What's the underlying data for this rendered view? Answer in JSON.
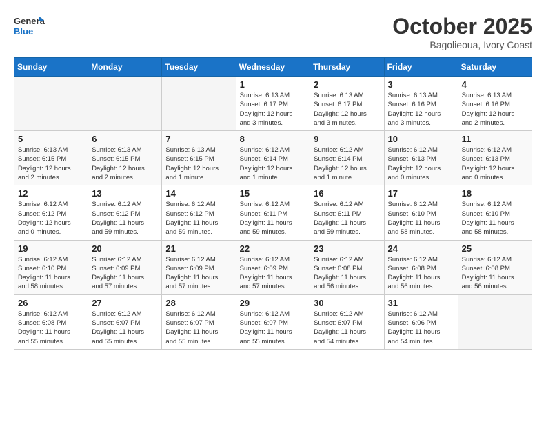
{
  "header": {
    "logo_line1": "General",
    "logo_line2": "Blue",
    "month": "October 2025",
    "location": "Bagolieoua, Ivory Coast"
  },
  "days_of_week": [
    "Sunday",
    "Monday",
    "Tuesday",
    "Wednesday",
    "Thursday",
    "Friday",
    "Saturday"
  ],
  "weeks": [
    [
      {
        "day": "",
        "info": ""
      },
      {
        "day": "",
        "info": ""
      },
      {
        "day": "",
        "info": ""
      },
      {
        "day": "1",
        "info": "Sunrise: 6:13 AM\nSunset: 6:17 PM\nDaylight: 12 hours\nand 3 minutes."
      },
      {
        "day": "2",
        "info": "Sunrise: 6:13 AM\nSunset: 6:17 PM\nDaylight: 12 hours\nand 3 minutes."
      },
      {
        "day": "3",
        "info": "Sunrise: 6:13 AM\nSunset: 6:16 PM\nDaylight: 12 hours\nand 3 minutes."
      },
      {
        "day": "4",
        "info": "Sunrise: 6:13 AM\nSunset: 6:16 PM\nDaylight: 12 hours\nand 2 minutes."
      }
    ],
    [
      {
        "day": "5",
        "info": "Sunrise: 6:13 AM\nSunset: 6:15 PM\nDaylight: 12 hours\nand 2 minutes."
      },
      {
        "day": "6",
        "info": "Sunrise: 6:13 AM\nSunset: 6:15 PM\nDaylight: 12 hours\nand 2 minutes."
      },
      {
        "day": "7",
        "info": "Sunrise: 6:13 AM\nSunset: 6:15 PM\nDaylight: 12 hours\nand 1 minute."
      },
      {
        "day": "8",
        "info": "Sunrise: 6:12 AM\nSunset: 6:14 PM\nDaylight: 12 hours\nand 1 minute."
      },
      {
        "day": "9",
        "info": "Sunrise: 6:12 AM\nSunset: 6:14 PM\nDaylight: 12 hours\nand 1 minute."
      },
      {
        "day": "10",
        "info": "Sunrise: 6:12 AM\nSunset: 6:13 PM\nDaylight: 12 hours\nand 0 minutes."
      },
      {
        "day": "11",
        "info": "Sunrise: 6:12 AM\nSunset: 6:13 PM\nDaylight: 12 hours\nand 0 minutes."
      }
    ],
    [
      {
        "day": "12",
        "info": "Sunrise: 6:12 AM\nSunset: 6:12 PM\nDaylight: 12 hours\nand 0 minutes."
      },
      {
        "day": "13",
        "info": "Sunrise: 6:12 AM\nSunset: 6:12 PM\nDaylight: 11 hours\nand 59 minutes."
      },
      {
        "day": "14",
        "info": "Sunrise: 6:12 AM\nSunset: 6:12 PM\nDaylight: 11 hours\nand 59 minutes."
      },
      {
        "day": "15",
        "info": "Sunrise: 6:12 AM\nSunset: 6:11 PM\nDaylight: 11 hours\nand 59 minutes."
      },
      {
        "day": "16",
        "info": "Sunrise: 6:12 AM\nSunset: 6:11 PM\nDaylight: 11 hours\nand 59 minutes."
      },
      {
        "day": "17",
        "info": "Sunrise: 6:12 AM\nSunset: 6:10 PM\nDaylight: 11 hours\nand 58 minutes."
      },
      {
        "day": "18",
        "info": "Sunrise: 6:12 AM\nSunset: 6:10 PM\nDaylight: 11 hours\nand 58 minutes."
      }
    ],
    [
      {
        "day": "19",
        "info": "Sunrise: 6:12 AM\nSunset: 6:10 PM\nDaylight: 11 hours\nand 58 minutes."
      },
      {
        "day": "20",
        "info": "Sunrise: 6:12 AM\nSunset: 6:09 PM\nDaylight: 11 hours\nand 57 minutes."
      },
      {
        "day": "21",
        "info": "Sunrise: 6:12 AM\nSunset: 6:09 PM\nDaylight: 11 hours\nand 57 minutes."
      },
      {
        "day": "22",
        "info": "Sunrise: 6:12 AM\nSunset: 6:09 PM\nDaylight: 11 hours\nand 57 minutes."
      },
      {
        "day": "23",
        "info": "Sunrise: 6:12 AM\nSunset: 6:08 PM\nDaylight: 11 hours\nand 56 minutes."
      },
      {
        "day": "24",
        "info": "Sunrise: 6:12 AM\nSunset: 6:08 PM\nDaylight: 11 hours\nand 56 minutes."
      },
      {
        "day": "25",
        "info": "Sunrise: 6:12 AM\nSunset: 6:08 PM\nDaylight: 11 hours\nand 56 minutes."
      }
    ],
    [
      {
        "day": "26",
        "info": "Sunrise: 6:12 AM\nSunset: 6:08 PM\nDaylight: 11 hours\nand 55 minutes."
      },
      {
        "day": "27",
        "info": "Sunrise: 6:12 AM\nSunset: 6:07 PM\nDaylight: 11 hours\nand 55 minutes."
      },
      {
        "day": "28",
        "info": "Sunrise: 6:12 AM\nSunset: 6:07 PM\nDaylight: 11 hours\nand 55 minutes."
      },
      {
        "day": "29",
        "info": "Sunrise: 6:12 AM\nSunset: 6:07 PM\nDaylight: 11 hours\nand 55 minutes."
      },
      {
        "day": "30",
        "info": "Sunrise: 6:12 AM\nSunset: 6:07 PM\nDaylight: 11 hours\nand 54 minutes."
      },
      {
        "day": "31",
        "info": "Sunrise: 6:12 AM\nSunset: 6:06 PM\nDaylight: 11 hours\nand 54 minutes."
      },
      {
        "day": "",
        "info": ""
      }
    ]
  ]
}
